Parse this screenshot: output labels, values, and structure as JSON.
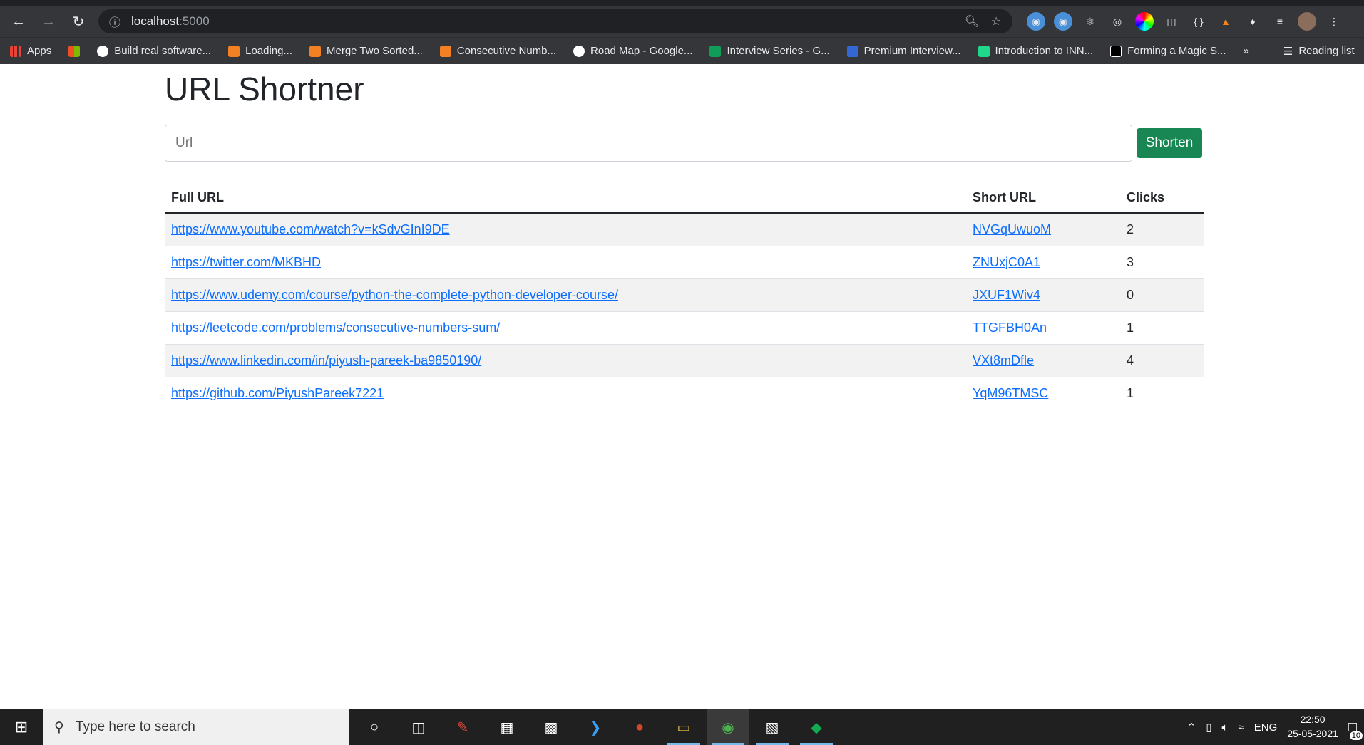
{
  "browser": {
    "url_host": "localhost",
    "url_port": ":5000",
    "bookmarks": [
      {
        "label": "Apps",
        "color": "#ea4335"
      },
      {
        "label": "",
        "color": "#f25022"
      },
      {
        "label": "Build real software...",
        "color": "#ffffff"
      },
      {
        "label": "Loading...",
        "color": "#f48024"
      },
      {
        "label": "Merge Two Sorted...",
        "color": "#f48024"
      },
      {
        "label": "Consecutive Numb...",
        "color": "#f48024"
      },
      {
        "label": "Road Map - Google...",
        "color": "#ffffff"
      },
      {
        "label": "Interview Series - G...",
        "color": "#0f9d58"
      },
      {
        "label": "Premium Interview...",
        "color": "#3367d6"
      },
      {
        "label": "Introduction to INN...",
        "color": "#21d789"
      },
      {
        "label": "Forming a Magic S...",
        "color": "#ffffff"
      }
    ],
    "more_label": "»",
    "reading_list_label": "Reading list"
  },
  "page": {
    "title": "URL Shortner",
    "input_placeholder": "Url",
    "shorten_label": "Shorten",
    "headers": {
      "full": "Full URL",
      "short": "Short URL",
      "clicks": "Clicks"
    },
    "rows": [
      {
        "full": "https://www.youtube.com/watch?v=kSdvGInI9DE",
        "short": "NVGqUwuoM",
        "clicks": "2"
      },
      {
        "full": "https://twitter.com/MKBHD",
        "short": "ZNUxjC0A1",
        "clicks": "3"
      },
      {
        "full": "https://www.udemy.com/course/python-the-complete-python-developer-course/",
        "short": "JXUF1Wiv4",
        "clicks": "0"
      },
      {
        "full": "https://leetcode.com/problems/consecutive-numbers-sum/",
        "short": "TTGFBH0An",
        "clicks": "1"
      },
      {
        "full": "https://www.linkedin.com/in/piyush-pareek-ba9850190/",
        "short": "VXt8mDfle",
        "clicks": "4"
      },
      {
        "full": "https://github.com/PiyushPareek7221",
        "short": "YqM96TMSC",
        "clicks": "1"
      }
    ]
  },
  "taskbar": {
    "search_placeholder": "Type here to search",
    "lang": "ENG",
    "time": "22:50",
    "date": "25-05-2021",
    "notification_count": "10"
  },
  "colors": {
    "accent_button": "#198754",
    "link": "#0d6efd"
  }
}
